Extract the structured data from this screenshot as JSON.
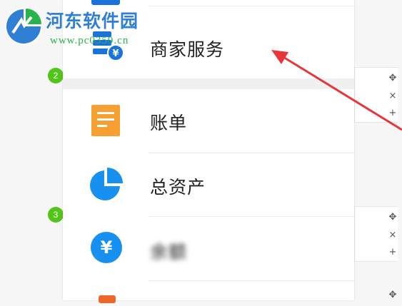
{
  "watermark": {
    "title": "河东软件园",
    "url": "www.pc0359.cn"
  },
  "steps": [
    "2",
    "3"
  ],
  "side_tools": {
    "move": "✥",
    "close": "×",
    "add": "+"
  },
  "menu": {
    "items": [
      {
        "label": "商家服务",
        "icon": "merchant-service-icon",
        "color": "#1a73d9"
      },
      {
        "label": "账单",
        "icon": "bill-icon",
        "color": "#f5a030"
      },
      {
        "label": "总资产",
        "icon": "pie-chart-icon",
        "color": "#1890f0"
      },
      {
        "label": "余额",
        "icon": "yuan-icon",
        "color": "#1890f0",
        "blurred": true
      }
    ]
  },
  "colors": {
    "accent_blue": "#1890f0",
    "orange": "#f5a030",
    "arrow_red": "#e8353b",
    "step_green": "#52c41a"
  }
}
